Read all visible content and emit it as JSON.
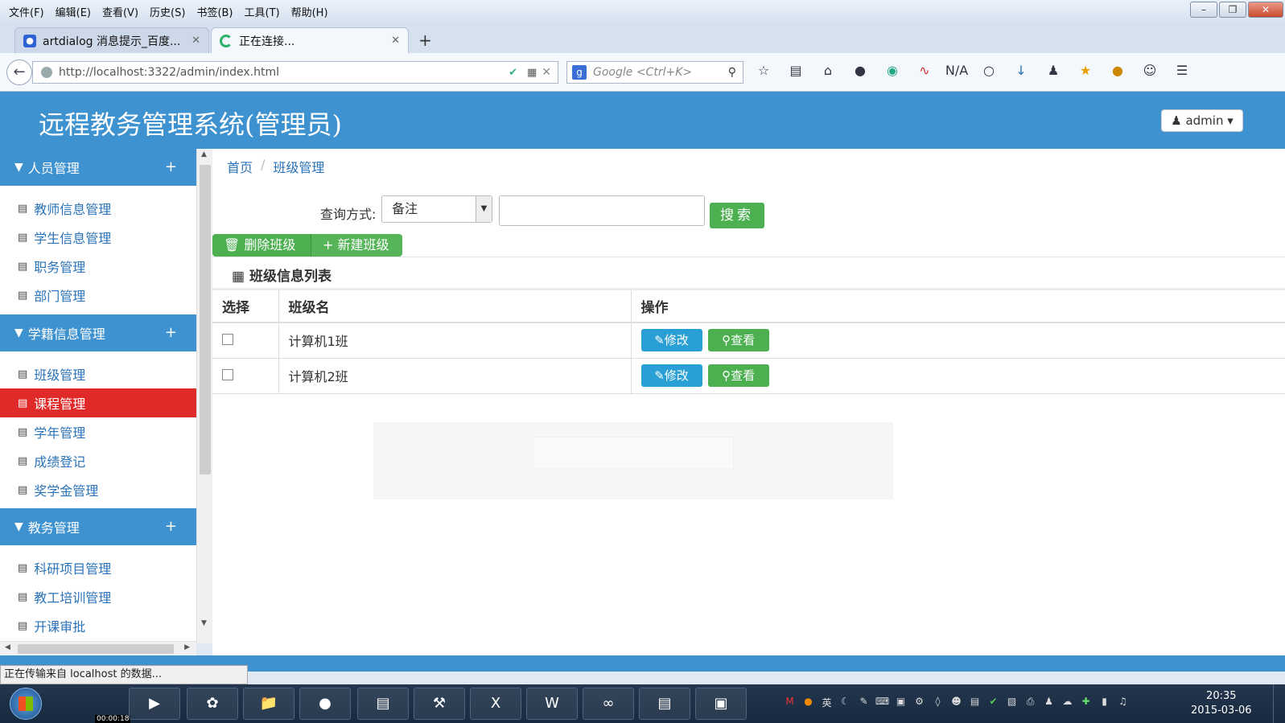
{
  "menubar": [
    "文件(F)",
    "编辑(E)",
    "查看(V)",
    "历史(S)",
    "书签(B)",
    "工具(T)",
    "帮助(H)"
  ],
  "tabs": [
    {
      "title": "artdialog 消息提示_百度...",
      "favicon": "paw-icon"
    },
    {
      "title": "正在连接...",
      "favicon": "loading-spinner-icon"
    }
  ],
  "url": "http://localhost:3322/admin/index.html",
  "search_placeholder": "Google <Ctrl+K>",
  "toolbar_na": "N/A",
  "app": {
    "title": "远程教务管理系统(管理员)",
    "user": "admin"
  },
  "sidebar": {
    "groups": [
      {
        "label": "人员管理",
        "items": [
          "教师信息管理",
          "学生信息管理",
          "职务管理",
          "部门管理"
        ]
      },
      {
        "label": "学籍信息管理",
        "items": [
          "班级管理",
          "课程管理",
          "学年管理",
          "成绩登记",
          "奖学金管理"
        ]
      },
      {
        "label": "教务管理",
        "items": [
          "科研项目管理",
          "教工培训管理",
          "开课审批"
        ]
      }
    ],
    "active_item": "课程管理"
  },
  "breadcrumb": {
    "home": "首页",
    "current": "班级管理"
  },
  "query": {
    "label": "查询方式:",
    "select_value": "备注",
    "search_btn": "搜索"
  },
  "actions": {
    "delete": "删除班级",
    "create": "新建班级"
  },
  "panel_title": "班级信息列表",
  "table": {
    "headers": [
      "选择",
      "班级名",
      "操作"
    ],
    "rows": [
      {
        "name": "计算机1班",
        "edit": "修改",
        "view": "查看"
      },
      {
        "name": "计算机2班",
        "edit": "修改",
        "view": "查看"
      }
    ]
  },
  "status_text": "正在传输来自 localhost 的数据...",
  "taskbar": {
    "clock_time": "20:35",
    "clock_date": "2015-03-06",
    "recording_time": "00:00:18"
  },
  "colors": {
    "header_blue": "#3d92cf",
    "active_red": "#e02a2a",
    "green": "#4caf50",
    "edit_blue": "#2a9fd6"
  }
}
